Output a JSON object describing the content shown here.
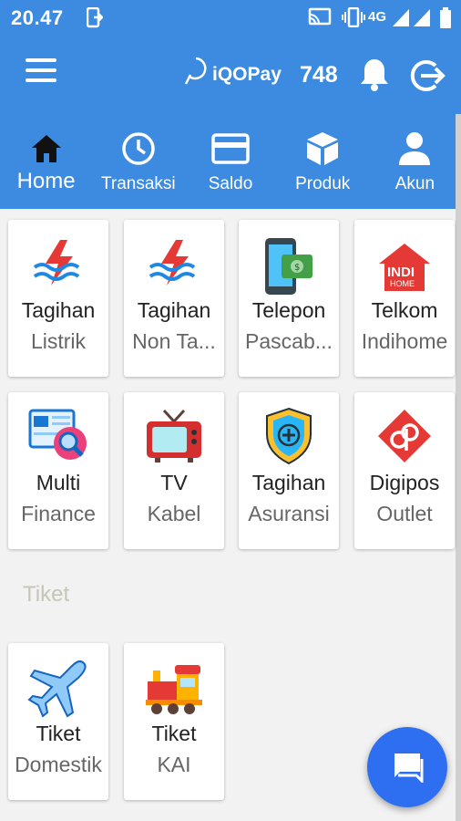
{
  "status_bar": {
    "time": "20.47",
    "network": "4G"
  },
  "app_bar": {
    "brand": "iQOPay",
    "balance": "748"
  },
  "tabs": [
    {
      "label": "Home",
      "icon": "home-icon",
      "active": true
    },
    {
      "label": "Transaksi",
      "icon": "clock-icon",
      "active": false
    },
    {
      "label": "Saldo",
      "icon": "card-icon",
      "active": false
    },
    {
      "label": "Produk",
      "icon": "box-icon",
      "active": false
    },
    {
      "label": "Akun",
      "icon": "person-icon",
      "active": false
    }
  ],
  "products": [
    {
      "title": "Tagihan",
      "subtitle": "Listrik",
      "icon": "electricity-icon"
    },
    {
      "title": "Tagihan",
      "subtitle": "Non Ta...",
      "icon": "electricity-icon"
    },
    {
      "title": "Telepon",
      "subtitle": "Pascab...",
      "icon": "phone-bill-icon"
    },
    {
      "title": "Telkom",
      "subtitle": "Indihome",
      "icon": "indihome-icon"
    },
    {
      "title": "Multi",
      "subtitle": "Finance",
      "icon": "finance-icon"
    },
    {
      "title": "TV",
      "subtitle": "Kabel",
      "icon": "tv-icon"
    },
    {
      "title": "Tagihan",
      "subtitle": "Asuransi",
      "icon": "insurance-shield-icon"
    },
    {
      "title": "Digipos",
      "subtitle": "Outlet",
      "icon": "digipos-icon"
    }
  ],
  "section_tiket": {
    "label": "Tiket",
    "items": [
      {
        "title": "Tiket",
        "subtitle": "Domestik",
        "icon": "airplane-icon"
      },
      {
        "title": "Tiket",
        "subtitle": "KAI",
        "icon": "train-icon"
      }
    ]
  },
  "indihome_logo": {
    "line1": "INDI",
    "line2": "HOME"
  },
  "colors": {
    "primary": "#3d8be0",
    "fab": "#2d6ff0",
    "electric_red": "#e53935",
    "electric_blue": "#1e88e5"
  }
}
